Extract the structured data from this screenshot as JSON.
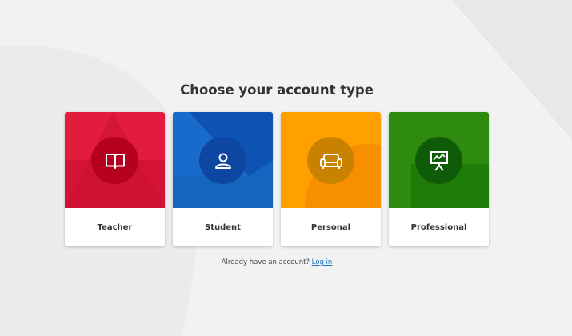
{
  "title": "Choose your account type",
  "cards": [
    {
      "label": "Teacher",
      "icon": "book-icon",
      "color": "#e31c3d",
      "dark": "#b5001f"
    },
    {
      "label": "Student",
      "icon": "user-icon",
      "color": "#1565c0",
      "dark": "#0d47a1"
    },
    {
      "label": "Personal",
      "icon": "couch-icon",
      "color": "#ffa000",
      "dark": "#c98200"
    },
    {
      "label": "Professional",
      "icon": "presentation-icon",
      "color": "#2e8b10",
      "dark": "#0f5c08"
    }
  ],
  "login": {
    "prompt": "Already have an account?",
    "link_label": "Log in"
  }
}
